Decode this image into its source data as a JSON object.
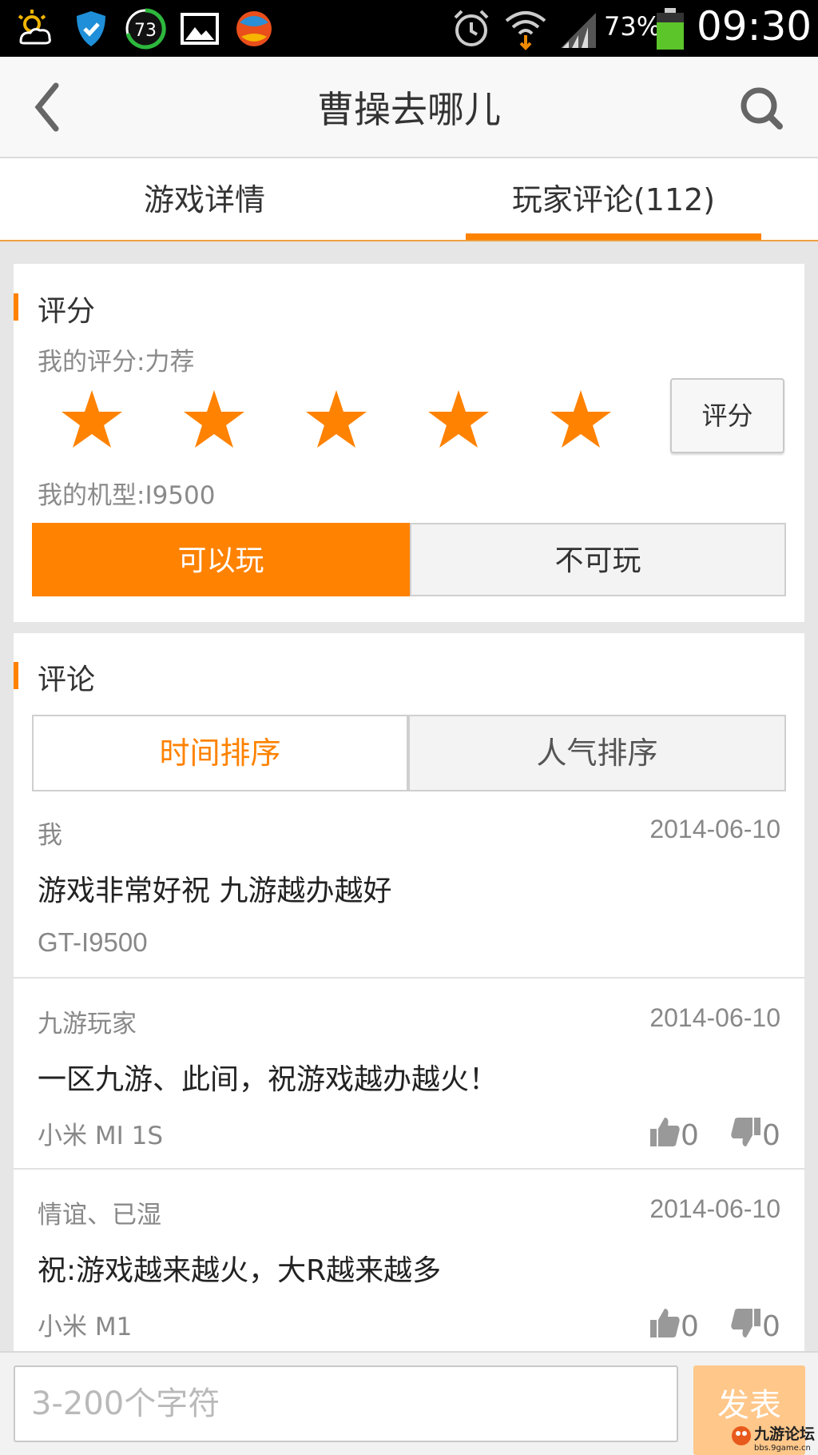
{
  "status_bar": {
    "battery_percent": "73%",
    "time": "09:30",
    "notification_count": "73",
    "icons": [
      "weather-icon",
      "shield-icon",
      "badge-icon",
      "image-icon",
      "browser-icon",
      "alarm-icon",
      "wifi-icon",
      "signal-icon",
      "battery-icon"
    ]
  },
  "titlebar": {
    "title": "曹操去哪儿"
  },
  "tabs": [
    {
      "label": "游戏详情",
      "active": false
    },
    {
      "label": "玩家评论(112)",
      "active": true
    }
  ],
  "rating": {
    "section_title": "评分",
    "my_rating": "我的评分:力荐",
    "stars_filled": 5,
    "stars_total": 5,
    "rate_button": "评分",
    "my_device": "我的机型:I9500",
    "playable_label": "可以玩",
    "unplayable_label": "不可玩"
  },
  "comments_section": {
    "section_title": "评论",
    "sort_time": "时间排序",
    "sort_popular": "人气排序"
  },
  "comments": [
    {
      "user": "我",
      "date": "2014-06-10",
      "text": "游戏非常好祝 九游越办越好",
      "device": "GT-I9500",
      "likes": null,
      "dislikes": null
    },
    {
      "user": "九游玩家",
      "date": "2014-06-10",
      "text": "一区九游、此间，祝游戏越办越火！",
      "device": "小米 MI 1S",
      "likes": "0",
      "dislikes": "0"
    },
    {
      "user": "情谊、已湿",
      "date": "2014-06-10",
      "text": "祝:游戏越来越火，大R越来越多",
      "device": "小米 M1",
      "likes": "0",
      "dislikes": "0"
    }
  ],
  "bottom_bar": {
    "placeholder": "3-200个字符",
    "send_label": "发表"
  },
  "watermark": {
    "text": "九游论坛",
    "url": "bbs.9game.cn"
  },
  "colors": {
    "accent": "#ff8200",
    "send_disabled": "#ffc78a"
  }
}
